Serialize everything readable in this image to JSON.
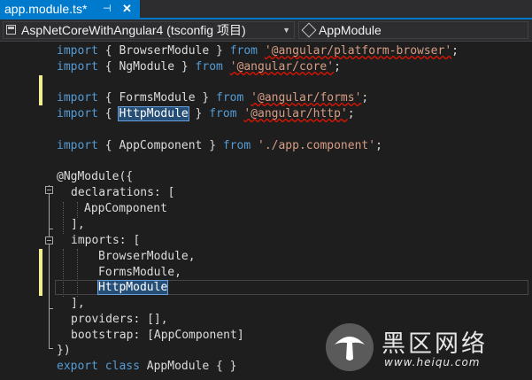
{
  "tab": {
    "title": "app.module.ts*",
    "pin_icon": "pin-icon",
    "close_icon": "close-icon",
    "pin_glyph": "⊣",
    "close_glyph": "✕"
  },
  "navbar": {
    "project": "AspNetCoreWithAngular4 (tsconfig 项目)",
    "project_icon": "project-icon",
    "dropdown_glyph": "▼",
    "symbol": "AppModule",
    "symbol_icon": "module-icon"
  },
  "code": {
    "l1": {
      "import": "import",
      "open": " { BrowserModule } ",
      "from": "from",
      "sp": " ",
      "path": "'@angular/platform-browser'",
      "end": ";"
    },
    "l2": {
      "import": "import",
      "open": " { NgModule } ",
      "from": "from",
      "sp": " ",
      "path": "'@angular/core'",
      "end": ";"
    },
    "l3": {
      "import": "import",
      "open": " { FormsModule } ",
      "from": "from",
      "sp": " ",
      "path": "'@angular/forms'",
      "end": ";"
    },
    "l4": {
      "import": "import",
      "open": " { ",
      "name": "HttpModule",
      "close": " } ",
      "from": "from",
      "sp": " ",
      "path": "'@angular/http'",
      "end": ";"
    },
    "l5": {
      "import": "import",
      "open": " { AppComponent } ",
      "from": "from",
      "sp": " ",
      "path": "'./app.component'",
      "end": ";"
    },
    "l6": "@NgModule({",
    "l7": "declarations: [",
    "l8": "AppComponent",
    "l9": "],",
    "l10": "imports: [",
    "l11": "BrowserModule,",
    "l12": "FormsModule,",
    "l13": "HttpModule",
    "l14": "],",
    "l15": "providers: [],",
    "l16": "bootstrap: [AppComponent]",
    "l17": "})",
    "l18": {
      "export": "export",
      "class": "class",
      "rest": " AppModule { }"
    }
  },
  "watermark": {
    "cn": "黑区网络",
    "url": "www.heiqu.com"
  },
  "colors": {
    "accent": "#007acc",
    "keyword": "#569cd6",
    "string": "#d69d85",
    "text": "#dcdcdc",
    "change_marker": "#efef91"
  }
}
